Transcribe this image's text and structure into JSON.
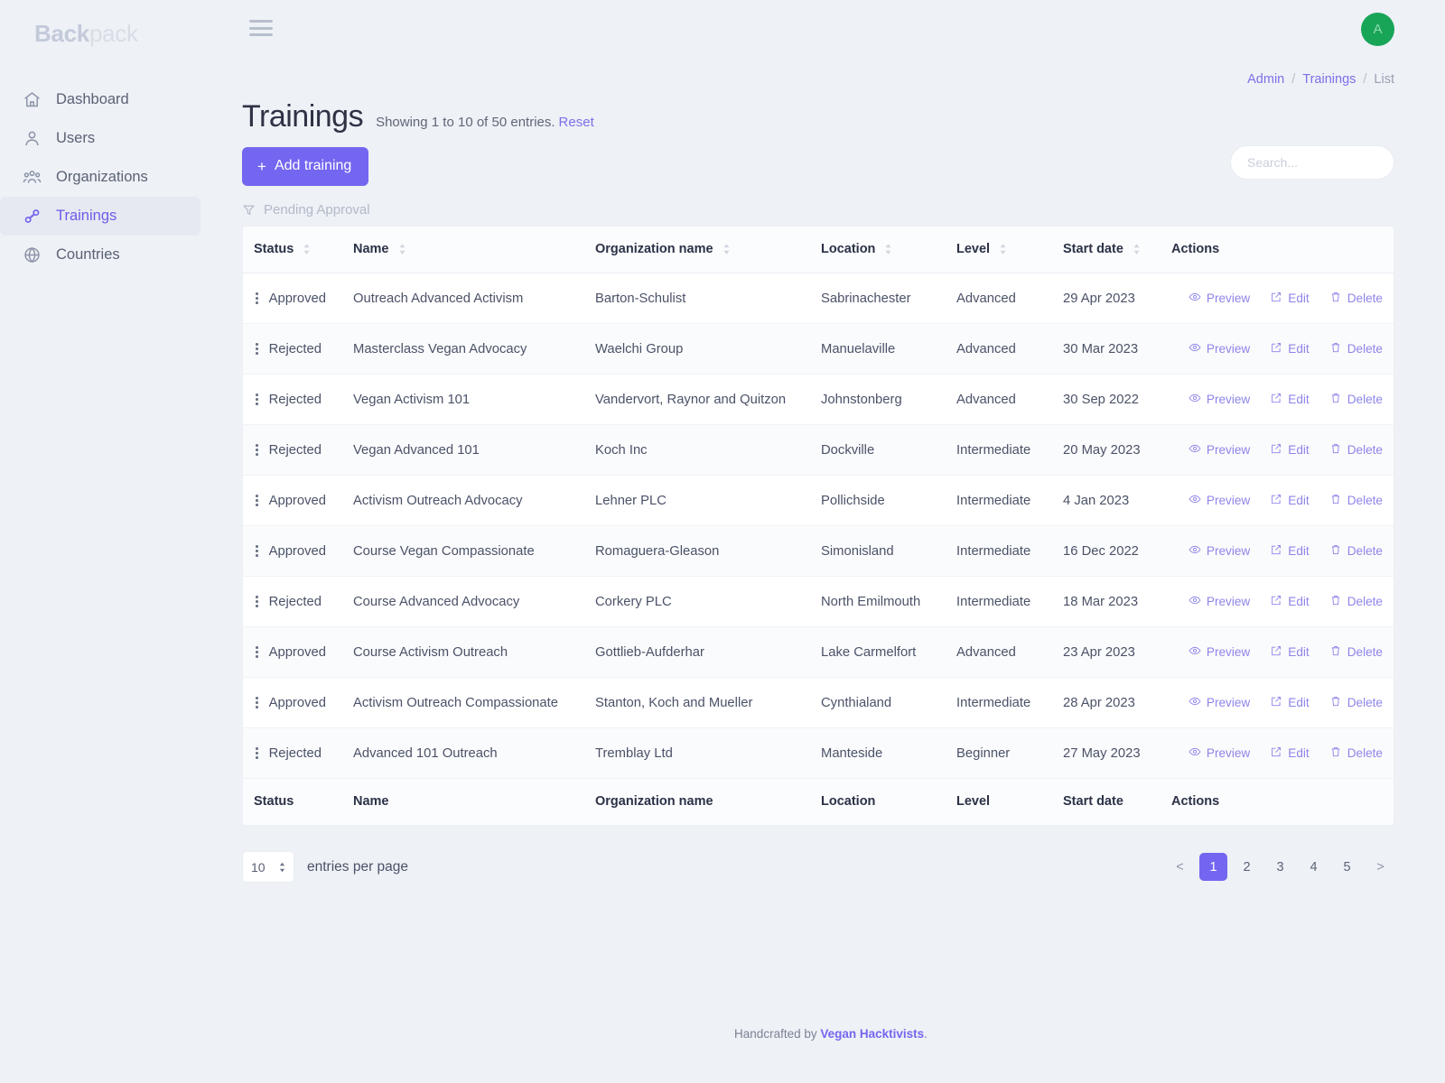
{
  "brand": {
    "strong": "Back",
    "light": "pack"
  },
  "sidebar": {
    "items": [
      {
        "label": "Dashboard",
        "icon": "home-icon"
      },
      {
        "label": "Users",
        "icon": "user-icon"
      },
      {
        "label": "Organizations",
        "icon": "users-group-icon"
      },
      {
        "label": "Trainings",
        "icon": "link-chain-icon"
      },
      {
        "label": "Countries",
        "icon": "globe-icon"
      }
    ]
  },
  "topbar": {
    "menu_icon": "hamburger-icon",
    "avatar_initial": "A",
    "avatar_color": "#18a558"
  },
  "breadcrumb": {
    "items": [
      "Admin",
      "Trainings",
      "List"
    ],
    "separator": "/"
  },
  "header": {
    "title": "Trainings",
    "showing": "Showing 1 to 10 of 50 entries.",
    "reset_label": "Reset",
    "add_button": "Add training",
    "add_button_plus": "+"
  },
  "search": {
    "placeholder": "Search...",
    "value": ""
  },
  "filter": {
    "label": "Pending Approval",
    "icon": "funnel-icon"
  },
  "table": {
    "columns": [
      {
        "label": "Status",
        "sortable": true
      },
      {
        "label": "Name",
        "sortable": true
      },
      {
        "label": "Organization name",
        "sortable": true
      },
      {
        "label": "Location",
        "sortable": true
      },
      {
        "label": "Level",
        "sortable": true
      },
      {
        "label": "Start date",
        "sortable": true
      },
      {
        "label": "Actions",
        "sortable": false
      }
    ],
    "action_labels": {
      "preview": "Preview",
      "edit": "Edit",
      "delete": "Delete"
    },
    "rows": [
      {
        "status": "Approved",
        "name": "Outreach Advanced Activism",
        "org": "Barton-Schulist",
        "location": "Sabrinachester",
        "level": "Advanced",
        "start_date": "29 Apr 2023"
      },
      {
        "status": "Rejected",
        "name": "Masterclass Vegan Advocacy",
        "org": "Waelchi Group",
        "location": "Manuelaville",
        "level": "Advanced",
        "start_date": "30 Mar 2023"
      },
      {
        "status": "Rejected",
        "name": "Vegan Activism 101",
        "org": "Vandervort, Raynor and Quitzon",
        "location": "Johnstonberg",
        "level": "Advanced",
        "start_date": "30 Sep 2022"
      },
      {
        "status": "Rejected",
        "name": "Vegan Advanced 101",
        "org": "Koch Inc",
        "location": "Dockville",
        "level": "Intermediate",
        "start_date": "20 May 2023"
      },
      {
        "status": "Approved",
        "name": "Activism Outreach Advocacy",
        "org": "Lehner PLC",
        "location": "Pollichside",
        "level": "Intermediate",
        "start_date": "4 Jan 2023"
      },
      {
        "status": "Approved",
        "name": "Course Vegan Compassionate",
        "org": "Romaguera-Gleason",
        "location": "Simonisland",
        "level": "Intermediate",
        "start_date": "16 Dec 2022"
      },
      {
        "status": "Rejected",
        "name": "Course Advanced Advocacy",
        "org": "Corkery PLC",
        "location": "North Emilmouth",
        "level": "Intermediate",
        "start_date": "18 Mar 2023"
      },
      {
        "status": "Approved",
        "name": "Course Activism Outreach",
        "org": "Gottlieb-Aufderhar",
        "location": "Lake Carmelfort",
        "level": "Advanced",
        "start_date": "23 Apr 2023"
      },
      {
        "status": "Approved",
        "name": "Activism Outreach Compassionate",
        "org": "Stanton, Koch and Mueller",
        "location": "Cynthialand",
        "level": "Intermediate",
        "start_date": "28 Apr 2023"
      },
      {
        "status": "Rejected",
        "name": "Advanced 101 Outreach",
        "org": "Tremblay Ltd",
        "location": "Manteside",
        "level": "Beginner",
        "start_date": "27 May 2023"
      }
    ]
  },
  "pager": {
    "entries_value": "10",
    "entries_label": "entries per page",
    "prev": "<",
    "next": ">",
    "pages": [
      "1",
      "2",
      "3",
      "4",
      "5"
    ],
    "active_page": "1"
  },
  "footer": {
    "prefix": "Handcrafted by ",
    "link": "Vegan Hacktivists",
    "suffix": "."
  },
  "colors": {
    "accent": "#7366f0",
    "link": "#7e6fe8",
    "page_bg": "#eef1f6"
  }
}
